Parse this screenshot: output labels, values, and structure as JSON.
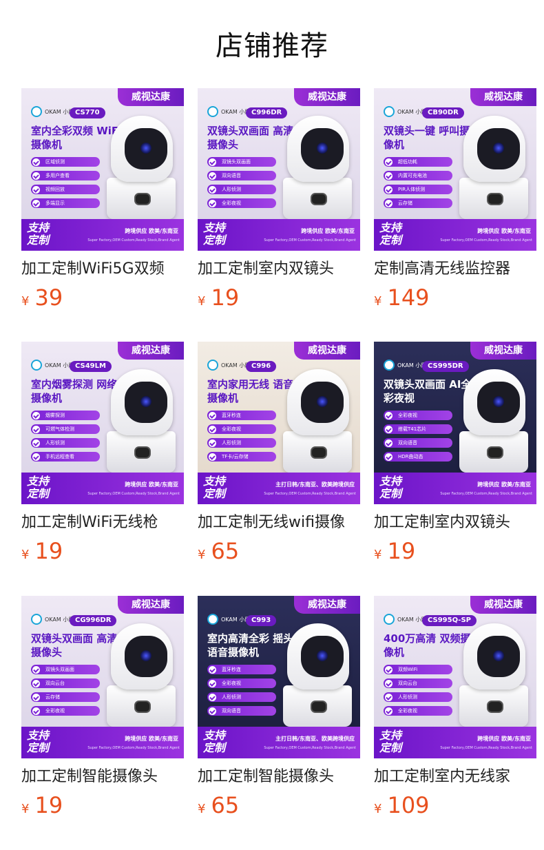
{
  "page": {
    "title": "店铺推荐"
  },
  "products": [
    {
      "badge": "威视达康",
      "brand": "OKAM 小鹰看看",
      "model": "CS770",
      "headline": "室内全彩双频 WiFi摄像机",
      "features": [
        "区域侦测",
        "多用户查看",
        "视频回放",
        "多端显示"
      ],
      "promo": "支持 定制",
      "promo_sub": "跨境供应 欧美/东南亚",
      "promo_tiny": "Super Factory,OEM Custom,Ready Stock,Brand Agent",
      "name": "加工定制WiFi5G双频",
      "currency": "¥",
      "price": "39",
      "theme": "light"
    },
    {
      "badge": "威视达康",
      "brand": "OKAM 小鹰看看",
      "model": "C996DR",
      "headline": "双镜头双画面 高清摄像头",
      "features": [
        "双镜头双画面",
        "双向语音",
        "人形侦测",
        "全彩夜视"
      ],
      "promo": "支持 定制",
      "promo_sub": "跨境供应 欧美/东南亚",
      "promo_tiny": "Super Factory,OEM Custom,Ready Stock,Brand Agent",
      "name": "加工定制室内双镜头",
      "currency": "¥",
      "price": "19",
      "theme": "light"
    },
    {
      "badge": "威视达康",
      "brand": "OKAM 小鹰看看",
      "model": "CB90DR",
      "headline": "双镜头一键 呼叫摄像机",
      "features": [
        "超低功耗",
        "内置可充电池",
        "PIR人体侦测",
        "云存储"
      ],
      "promo": "支持 定制",
      "promo_sub": "跨境供应 欧美/东南亚",
      "promo_tiny": "Super Factory,OEM Custom,Ready Stock,Brand Agent",
      "name": "定制高清无线监控器",
      "currency": "¥",
      "price": "149",
      "theme": "light"
    },
    {
      "badge": "威视达康",
      "brand": "OKAM 小鹰看看",
      "model": "CS49LM",
      "headline": "室内烟雾探测 网络摄像机",
      "features": [
        "烟雾探测",
        "可燃气体检测",
        "人形侦测",
        "手机远程查看"
      ],
      "promo": "支持 定制",
      "promo_sub": "跨境供应 欧美/东南亚",
      "promo_tiny": "Super Factory,OEM Custom,Ready Stock,Brand Agent",
      "name": "加工定制WiFi无线枪",
      "currency": "¥",
      "price": "19",
      "theme": "light"
    },
    {
      "badge": "威视达康",
      "brand": "OKAM 小鹰看看",
      "model": "C996",
      "headline": "室内家用无线 语音摄像机",
      "features": [
        "蓝牙秒连",
        "全彩夜视",
        "人形侦测",
        "TF卡/云存储"
      ],
      "promo": "支持 定制",
      "promo_sub": "主打日韩/东南亚、欧美跨境供应",
      "promo_tiny": "Super Factory,OEM Custom,Ready Stock,Brand Agent",
      "name": "加工定制无线wifi摄像",
      "currency": "¥",
      "price": "65",
      "theme": "room"
    },
    {
      "badge": "威视达康",
      "brand": "OKAM 小鹰看看",
      "model": "CS995DR",
      "headline": "双镜头双画面 AI全彩夜视",
      "features": [
        "全彩夜视",
        "搭载T41芯片",
        "双向语音",
        "HDR曲动态"
      ],
      "promo": "支持 定制",
      "promo_sub": "跨境供应 欧美/东南亚",
      "promo_tiny": "Super Factory,OEM Custom,Ready Stock,Brand Agent",
      "name": "加工定制室内双镜头",
      "currency": "¥",
      "price": "19",
      "theme": "dark"
    },
    {
      "badge": "威视达康",
      "brand": "OKAM 小鹰看看",
      "model": "CG996DR",
      "headline": "双镜头双画面 高清摄像头",
      "features": [
        "双镜头双画面",
        "双向云台",
        "云存储",
        "全彩夜视"
      ],
      "promo": "支持 定制",
      "promo_sub": "跨境供应 欧美/东南亚",
      "promo_tiny": "Super Factory,OEM Custom,Ready Stock,Brand Agent",
      "name": "加工定制智能摄像头",
      "currency": "¥",
      "price": "19",
      "theme": "light"
    },
    {
      "badge": "威视达康",
      "brand": "OKAM 小鹰看看",
      "model": "C993",
      "headline": "室内高清全彩 摇头语音摄像机",
      "features": [
        "蓝牙秒连",
        "全彩夜视",
        "人形侦测",
        "双向语音"
      ],
      "promo": "支持 定制",
      "promo_sub": "主打日韩/东南亚、欧美跨境供应",
      "promo_tiny": "Super Factory,OEM Custom,Ready Stock,Brand Agent",
      "name": "加工定制智能摄像头",
      "currency": "¥",
      "price": "65",
      "theme": "dark"
    },
    {
      "badge": "威视达康",
      "brand": "OKAM 小鹰看看",
      "model": "CS995Q-SP",
      "headline": "400万高清 双频摄像机",
      "features": [
        "双频WiFi",
        "双向云台",
        "人形侦测",
        "全彩夜视"
      ],
      "promo": "支持 定制",
      "promo_sub": "跨境供应 欧美/东南亚",
      "promo_tiny": "Super Factory,OEM Custom,Ready Stock,Brand Agent",
      "name": "加工定制室内无线家",
      "currency": "¥",
      "price": "109",
      "theme": "light"
    }
  ]
}
